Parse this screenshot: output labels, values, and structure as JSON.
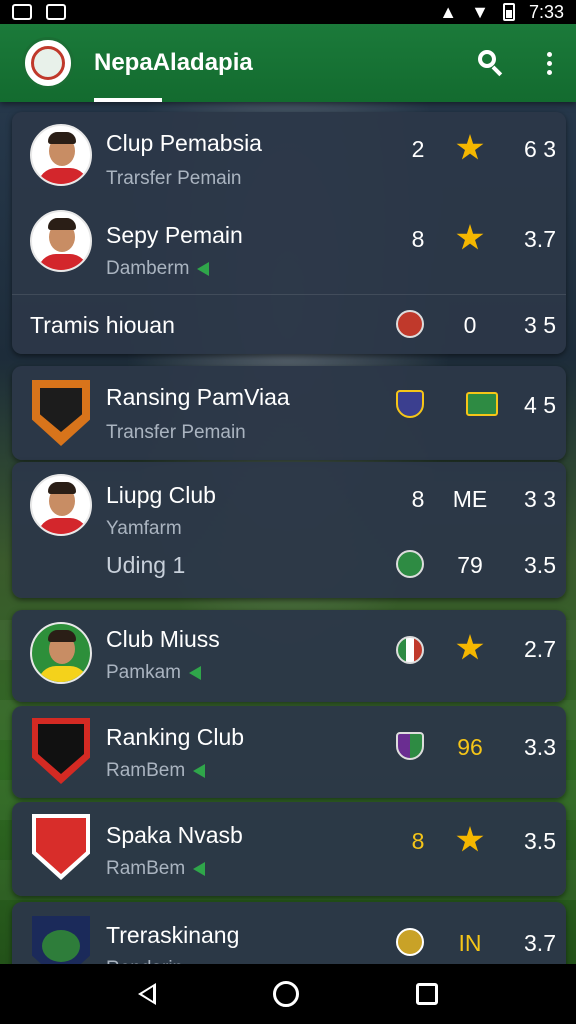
{
  "status_bar": {
    "time": "7:33"
  },
  "app_bar": {
    "title": "NepaAladapia"
  },
  "cards": [
    {
      "rows": [
        {
          "name": "Clup Pemabsia",
          "sub": "Trarsfer Pemain",
          "col1": "2",
          "col3": "6 3"
        },
        {
          "name": "Sepy Pemain",
          "sub": "Damberm",
          "col1": "8",
          "col3": "3.7"
        }
      ],
      "footer": {
        "name": "Tramis hiouan",
        "col2": "0",
        "col3": "3 5"
      }
    },
    {
      "rows": [
        {
          "name": "Ransing PamViaa",
          "sub": "Transfer Pemain",
          "col3": "4 5"
        }
      ]
    },
    {
      "rows": [
        {
          "name": "Liupg Club",
          "sub": "Yamfarm",
          "col1": "8",
          "col2": "ME",
          "col3": "3 3"
        },
        {
          "name": "Uding 1",
          "col2": "79",
          "col3": "3.5"
        }
      ]
    },
    {
      "rows": [
        {
          "name": "Club Miuss",
          "sub": "Pamkam",
          "col3": "2.7"
        }
      ]
    },
    {
      "rows": [
        {
          "name": "Ranking Club",
          "sub": "RamBem",
          "col2": "96",
          "col3": "3.3"
        }
      ]
    },
    {
      "rows": [
        {
          "name": "Spaka Nvasb",
          "sub": "RamBem",
          "col1": "8",
          "col3": "3.5"
        }
      ]
    },
    {
      "rows": [
        {
          "name": "Treraskinang",
          "sub": "Rendarin",
          "col2": "IN",
          "col3": "3.7"
        }
      ]
    }
  ]
}
